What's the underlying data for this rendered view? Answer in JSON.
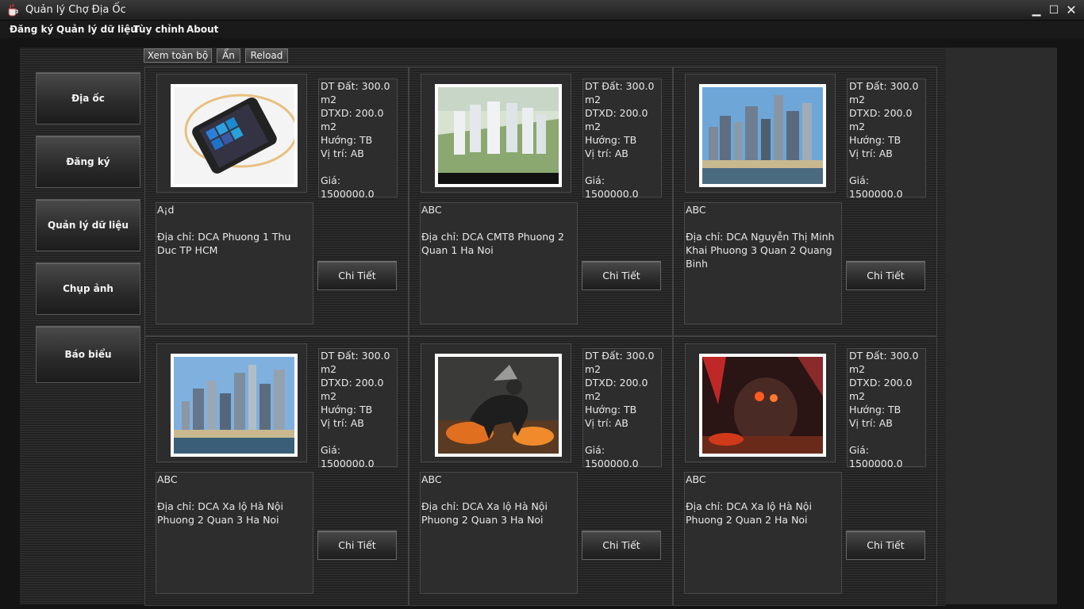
{
  "window": {
    "title": "Quản lý Chợ Địa Ốc",
    "minimize": "▁",
    "maximize": "☐",
    "close": "✕"
  },
  "menu": [
    "Đăng ký",
    "Quản lý dữ liệu",
    "Tùy chỉnh",
    "About"
  ],
  "toolbar": {
    "view_all": "Xem toàn bộ",
    "hide": "Ẩn",
    "reload": "Reload"
  },
  "sidebar": [
    "Địa ốc",
    "Đăng ký",
    "Quản lý dữ liệu",
    "Chụp ảnh",
    "Báo biểu"
  ],
  "listings": [
    {
      "image": "phone-image",
      "area": "DT Đất: 300.0 m2",
      "built": "DTXD: 200.0 m2",
      "direction": "Hướng: TB",
      "position": "Vị trí: AB",
      "price": "Giá: 1500000.0",
      "name": "A¡d",
      "address": "Địa chỉ: DCA  Phuong 1 Thu Duc TP HCM",
      "button": "Chi Tiết"
    },
    {
      "image": "apartment-complex-image",
      "area": "DT Đất: 300.0 m2",
      "built": "DTXD: 200.0 m2",
      "direction": "Hướng: TB",
      "position": "Vị trí: AB",
      "price": "Giá: 1500000.0",
      "name": "ABC",
      "address": "Địa chỉ: DCA CMT8 Phuong 2 Quan 1 Ha Noi",
      "button": "Chi Tiết"
    },
    {
      "image": "city-skyline-image",
      "area": "DT Đất: 300.0 m2",
      "built": "DTXD: 200.0 m2",
      "direction": "Hướng: TB",
      "position": "Vị trí: AB",
      "price": "Giá: 1500000.0",
      "name": "ABC",
      "address": "Địa chỉ: DCA Nguyễn Thị Minh Khai Phuong 3 Quan 2 Quang Binh",
      "button": "Chi Tiết"
    },
    {
      "image": "city-skyline-image",
      "area": "DT Đất: 300.0 m2",
      "built": "DTXD: 200.0 m2",
      "direction": "Hướng: TB",
      "position": "Vị trí: AB",
      "price": "Giá: 1500000.0",
      "name": "ABC",
      "address": "Địa chỉ: DCA Xa lộ Hà Nội Phuong 2 Quan 3 Ha Noi",
      "button": "Chi Tiết"
    },
    {
      "image": "fantasy-horse-image",
      "area": "DT Đất: 300.0 m2",
      "built": "DTXD: 200.0 m2",
      "direction": "Hướng: TB",
      "position": "Vị trí: AB",
      "price": "Giá: 1500000.0",
      "name": "ABC",
      "address": "Địa chỉ: DCA Xa lộ Hà Nội Phuong 2 Quan 3 Ha Noi",
      "button": "Chi Tiết"
    },
    {
      "image": "fire-monster-image",
      "area": "DT Đất: 300.0 m2",
      "built": "DTXD: 200.0 m2",
      "direction": "Hướng: TB",
      "position": "Vị trí: AB",
      "price": "Giá: 1500000.0",
      "name": "ABC",
      "address": "Địa chỉ: DCA Xa lộ Hà Nội Phuong 2 Quan 2 Ha Noi",
      "button": "Chi Tiết"
    }
  ]
}
